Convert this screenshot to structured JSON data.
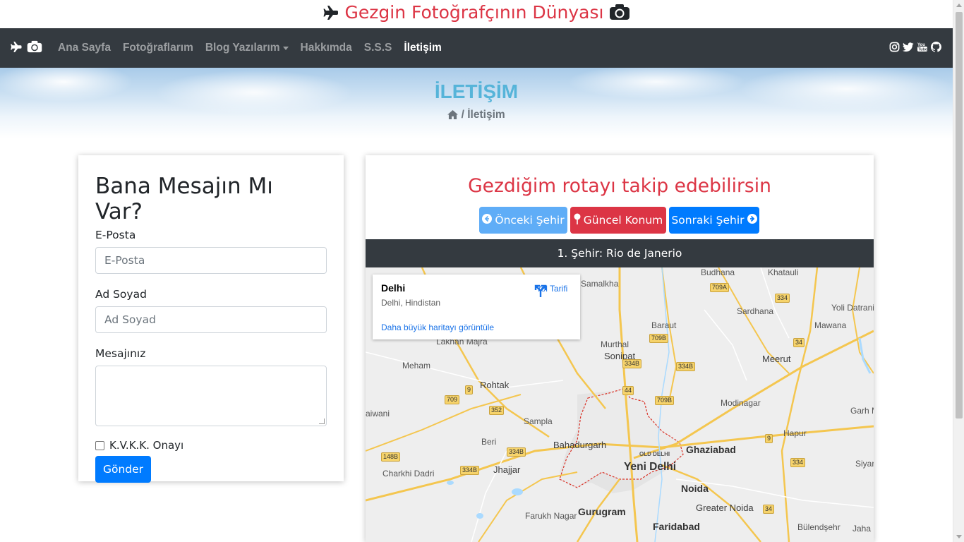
{
  "site": {
    "title": "Gezgin Fotoğrafçının Dünyası",
    "title_icons": [
      "plane-icon",
      "camera-icon"
    ]
  },
  "nav": {
    "items": [
      {
        "label": "Ana Sayfa"
      },
      {
        "label": "Fotoğraflarım"
      },
      {
        "label": "Blog Yazılarım"
      },
      {
        "label": "Hakkımda"
      },
      {
        "label": "S.S.S"
      },
      {
        "label": "İletişim"
      }
    ],
    "active": "İletişim",
    "social_icons": [
      "instagram-icon",
      "twitter-icon",
      "youtube-icon",
      "github-icon"
    ]
  },
  "hero": {
    "title": "İLETİŞİM",
    "breadcrumb_current": "İletişim"
  },
  "form": {
    "title": "Bana Mesajın Mı Var?",
    "email_label": "E-Posta",
    "email_placeholder": "E-Posta",
    "name_label": "Ad Soyad",
    "name_placeholder": "Ad Soyad",
    "message_label": "Mesajınız",
    "consent_label": "K.V.K.K. Onayı",
    "submit_label": "Gönder"
  },
  "route": {
    "title": "Gezdiğim rotayı takip edebilirsin",
    "prev_label": "Önceki Şehir",
    "current_label": "Güncel Konum",
    "next_label": "Sonraki Şehir",
    "city_label": "1. Şehir: Rio de Janerio"
  },
  "map": {
    "info_name": "Delhi",
    "info_address": "Delhi, Hindistan",
    "info_directions": "Yol Tarifi",
    "info_link": "Daha büyük haritayı görüntüle",
    "places": [
      "Budhana",
      "Khatauli",
      "Samalkha",
      "Sardhana",
      "Yoli Datrani",
      "Mawana",
      "Baraut",
      "Lakhan Majra",
      "Murthal",
      "Sonipat",
      "Meerut",
      "Meham",
      "Rohtak",
      "Modinagar",
      "Garh Mukte",
      "aiwani",
      "Sampla",
      "Hapur",
      "Beri",
      "Bahadurgarh",
      "OLD DELHI",
      "Ghaziabad",
      "Charkhi Dadri",
      "Jhajjar",
      "Yeni Delhi",
      "Siyar",
      "Noida",
      "Greater Noida",
      "Farukh Nagar",
      "Gurugram",
      "Faridabad",
      "Bülendşehr",
      "Jaha"
    ],
    "highways": [
      "709A",
      "334",
      "34",
      "709B",
      "334B",
      "44",
      "9",
      "709",
      "352",
      "148B",
      "334B",
      "334B",
      "709B",
      "334B",
      "9",
      "334",
      "34"
    ],
    "highway_color": "#f6d36b",
    "boundary_color": "#d93025"
  },
  "colors": {
    "brand_red": "#dc3545",
    "navbar": "#343a40",
    "primary": "#007bff",
    "hero_title": "#56b4d9"
  }
}
